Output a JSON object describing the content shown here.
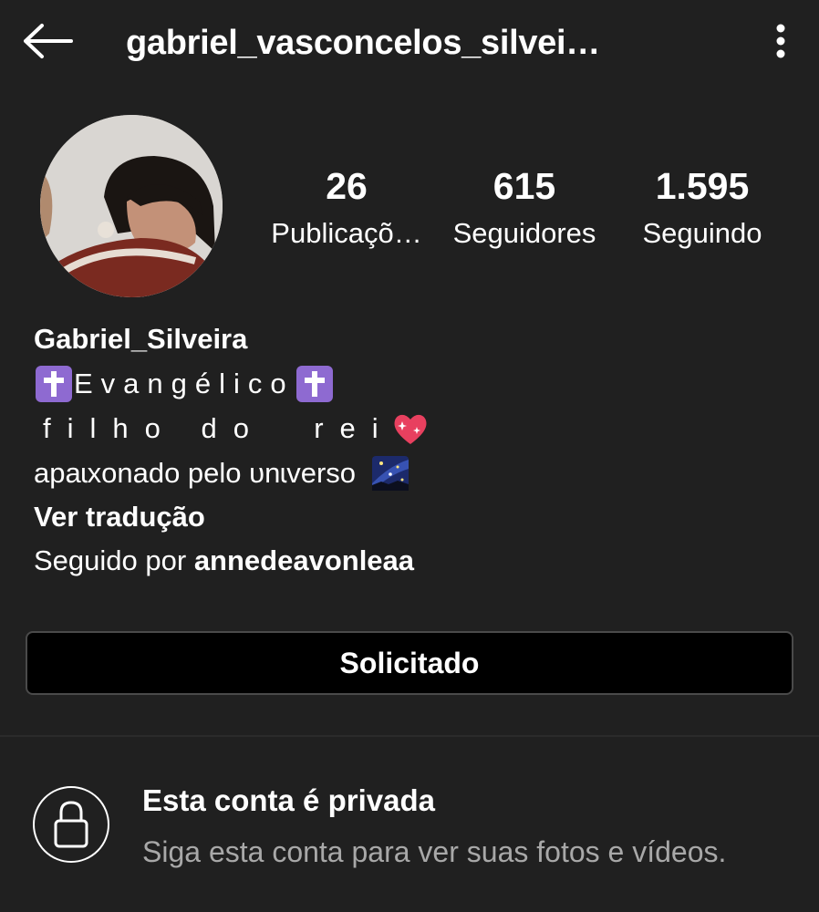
{
  "header": {
    "title": "gabriel_vasconcelos_silvei…",
    "back_icon": "arrow-left-icon",
    "more_icon": "more-vertical-icon"
  },
  "stats": [
    {
      "value": "26",
      "label": "Publicaçõ…"
    },
    {
      "value": "615",
      "label": "Seguidores"
    },
    {
      "value": "1.595",
      "label": "Seguindo"
    }
  ],
  "bio": {
    "name": "Gabriel_Silveira",
    "line1_text": "Evangélico",
    "line2_text": "filho do  rei",
    "line3_text": "apaɩxonado pelo υnɩverso",
    "see_translation": "Ver tradução",
    "followed_by_prefix": "Seguido por ",
    "followed_by_user": "annedeavonleaa"
  },
  "action_button": {
    "label": "Solicitado"
  },
  "private": {
    "title": "Esta conta é privada",
    "subtitle": "Siga esta conta para ver suas fotos e vídeos.",
    "icon": "lock-icon"
  },
  "colors": {
    "background": "#202020",
    "button_bg": "#000000",
    "button_border": "#4a4a4a",
    "muted_text": "#a8a8a8",
    "emoji_purple": "#8e6ad1",
    "heart_pink": "#e8405f"
  }
}
